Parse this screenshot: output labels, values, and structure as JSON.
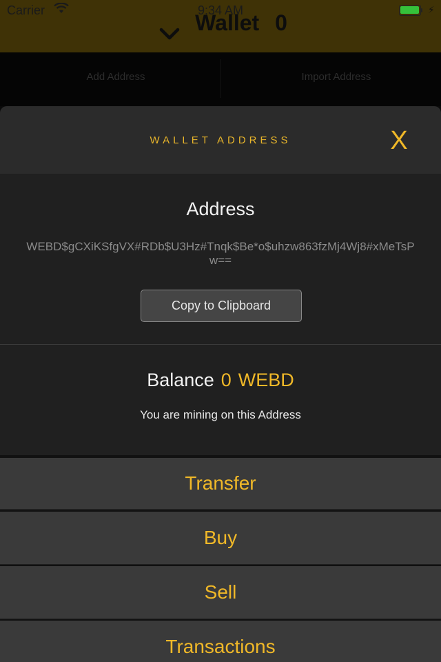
{
  "status_bar": {
    "carrier": "Carrier",
    "time": "9:34 AM",
    "battery_color": "#35c13a"
  },
  "background": {
    "title": "Wallet",
    "count": "0",
    "tabs": [
      "Add Address",
      "Import Address"
    ]
  },
  "modal": {
    "title": "WALLET ADDRESS",
    "close_label": "X",
    "address_heading": "Address",
    "address_value": "WEBD$gCXiKSfgVX#RDb$U3Hz#Tnqk$Be*o$uhzw863fzMj4Wj8#xMeTsPw==",
    "copy_button": "Copy to Clipboard",
    "balance_label": "Balance",
    "balance_amount": "0",
    "balance_unit": "WEBD",
    "mining_note": "You are mining on this Address",
    "actions": [
      "Transfer",
      "Buy",
      "Sell",
      "Transactions"
    ]
  },
  "colors": {
    "accent": "#f0b828",
    "header_bg": "#3f3206",
    "sheet_bg": "#1f1f1f",
    "button_bg": "#3a3a3a"
  }
}
